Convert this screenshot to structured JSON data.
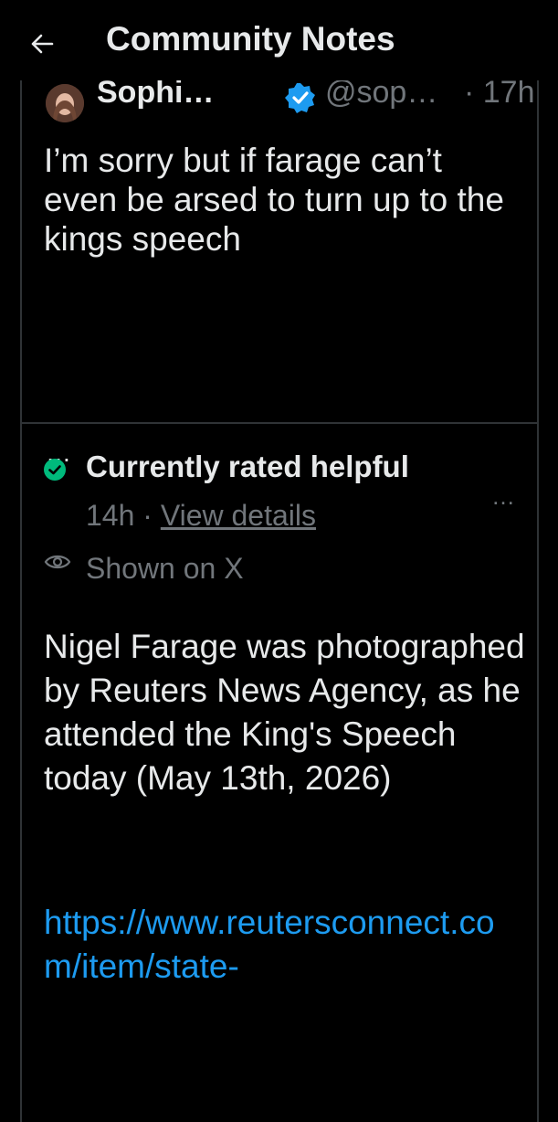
{
  "header": {
    "title": "Community Notes",
    "back_icon": "arrow-left-icon"
  },
  "tweet": {
    "author_name": "Sophi…",
    "handle": "@sop…",
    "time": "· 17h",
    "verified_icon": "verified-badge-icon",
    "verified_color": "#1d9bf0",
    "text": "I’m sorry but if farage can’t even be arsed to turn up to the kings speech",
    "more": "…"
  },
  "note": {
    "status_icon": "check-circle-icon",
    "status_color": "#00ba7c",
    "status_label": "Currently rated helpful",
    "age": "14h",
    "separator": " · ",
    "view_details": "View details",
    "menu": "…",
    "shown_icon": "eye-icon",
    "shown_label": "Shown on X",
    "text": "Nigel Farage was photographed by Reuters News Agency, as he attended the King's Speech today (May 13th, 2026)",
    "link": "https://www.reutersconnect.com/item/state-"
  },
  "colors": {
    "background": "#000000",
    "text": "#e7e9ea",
    "muted": "#71767b",
    "link": "#1d9bf0",
    "border": "#2f3336"
  }
}
